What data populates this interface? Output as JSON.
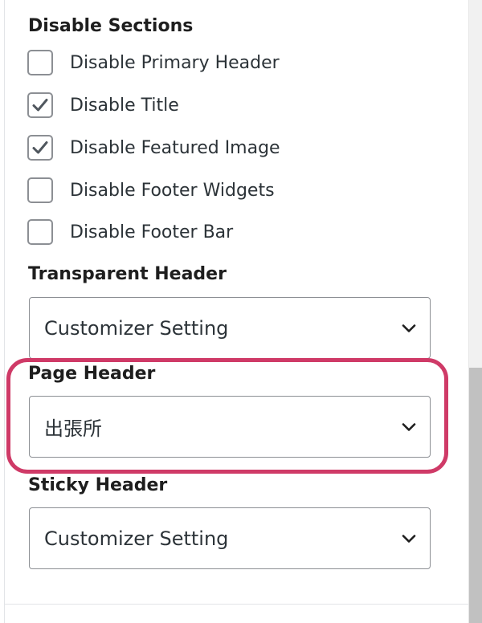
{
  "disable_sections": {
    "label": "Disable Sections",
    "options": [
      {
        "label": "Disable Primary Header",
        "checked": false
      },
      {
        "label": "Disable Title",
        "checked": true
      },
      {
        "label": "Disable Featured Image",
        "checked": true
      },
      {
        "label": "Disable Footer Widgets",
        "checked": false
      },
      {
        "label": "Disable Footer Bar",
        "checked": false
      }
    ]
  },
  "transparent_header": {
    "label": "Transparent Header",
    "selected": "Customizer Setting"
  },
  "page_header": {
    "label": "Page Header",
    "selected": "出張所"
  },
  "sticky_header": {
    "label": "Sticky Header",
    "selected": "Customizer Setting"
  },
  "colors": {
    "highlight": "#cf3a67",
    "checkmark": "#50575e"
  },
  "icons": {
    "checkbox_mark": "checkmark-icon",
    "select_arrow": "chevron-down-icon"
  }
}
